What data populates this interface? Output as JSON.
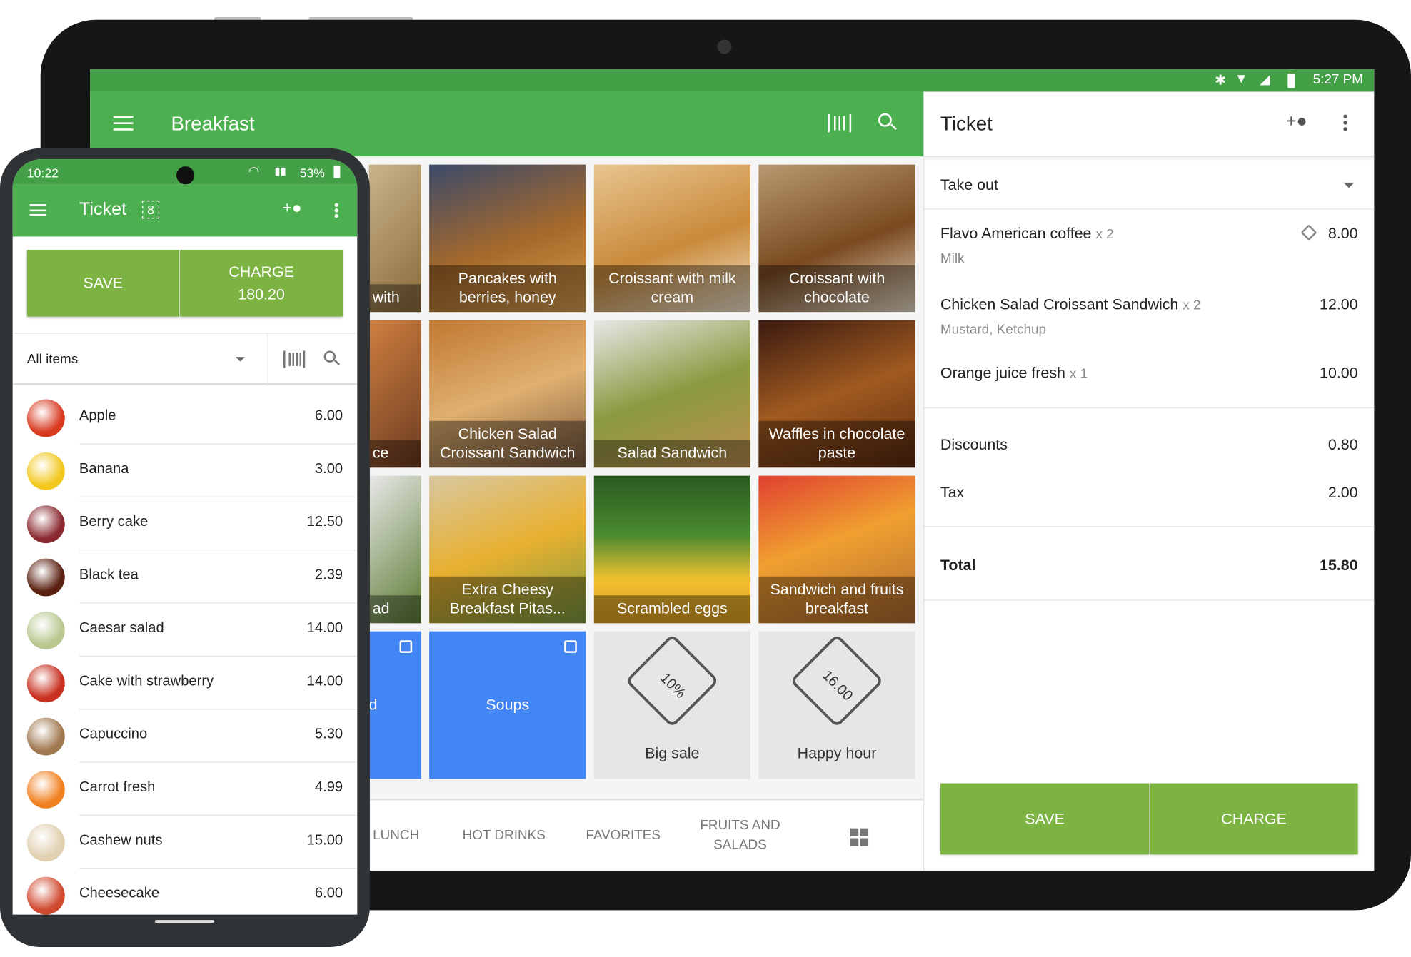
{
  "tablet": {
    "status": {
      "time": "5:27 PM"
    },
    "appbar": {
      "title": "Breakfast"
    },
    "tiles": [
      {
        "label": "with",
        "bg": "linear-gradient(135deg,#c9b48a,#8a6a3a)"
      },
      {
        "label": "Pancakes with berries, honey",
        "bg": "linear-gradient(160deg,#3b4a6a,#a86a2a 55%,#d9a050)"
      },
      {
        "label": "Croissant with milk cream",
        "bg": "linear-gradient(160deg,#e8c590,#c98a3a 55%,#f2e6d0)"
      },
      {
        "label": "Croissant with chocolate",
        "bg": "linear-gradient(160deg,#b89a70,#7a4a20 55%,#e8dcc8)"
      },
      {
        "label": "ce",
        "bg": "linear-gradient(135deg,#d08040,#6a3a20)"
      },
      {
        "label": "Chicken Salad Croissant Sandwich",
        "bg": "linear-gradient(160deg,#c07830,#e0b070 50%,#7a5a40)"
      },
      {
        "label": "Salad Sandwich",
        "bg": "linear-gradient(160deg,#e8e8e8,#8a9a40 50%,#c09050)"
      },
      {
        "label": "Waffles in chocolate paste",
        "bg": "linear-gradient(160deg,#3a1a10,#a05a20 50%,#5a2a10)"
      },
      {
        "label": "ad",
        "bg": "linear-gradient(135deg,#e8e8e8,#5a7a30)"
      },
      {
        "label": "Extra Cheesy Breakfast Pitas...",
        "bg": "linear-gradient(160deg,#d8c8a0,#e8b030 50%,#7a9a40)"
      },
      {
        "label": "Scrambled eggs",
        "bg": "linear-gradient(180deg,#2a5a20,#4a8a30 40%,#f0c030 70%,#e0a020)"
      },
      {
        "label": "Sandwich and fruits breakfast",
        "bg": "linear-gradient(160deg,#e04030,#f0a030 45%,#b06a30)"
      }
    ],
    "category_tiles": [
      {
        "label": "d"
      },
      {
        "label": "Soups"
      }
    ],
    "discount_tiles": [
      {
        "label": "Big sale",
        "tag": "10%"
      },
      {
        "label": "Happy hour",
        "tag": "16.00"
      }
    ],
    "tabs": [
      "LUNCH",
      "HOT DRINKS",
      "FAVORITES",
      "FRUITS AND SALADS"
    ],
    "ticket": {
      "title": "Ticket",
      "dining_option": "Take out",
      "items": [
        {
          "name": "Flavo American coffee",
          "qty": "x 2",
          "modifiers": "Milk",
          "price": "8.00"
        },
        {
          "name": "Chicken Salad Croissant Sandwich",
          "qty": "x 2",
          "modifiers": "Mustard, Ketchup",
          "price": "12.00"
        },
        {
          "name": "Orange juice fresh",
          "qty": "x 1",
          "modifiers": "",
          "price": "10.00"
        }
      ],
      "discounts_label": "Discounts",
      "discounts": "0.80",
      "tax_label": "Tax",
      "tax": "2.00",
      "total_label": "Total",
      "total": "15.80",
      "save": "SAVE",
      "charge": "CHARGE"
    }
  },
  "phone": {
    "status": {
      "time": "10:22",
      "battery": "53%"
    },
    "appbar": {
      "title": "Ticket",
      "ticket_count": "8"
    },
    "save": "SAVE",
    "charge": "CHARGE",
    "charge_amount": "180.20",
    "filter": "All items",
    "items": [
      {
        "name": "Apple",
        "price": "6.00",
        "color": "#d83a20"
      },
      {
        "name": "Banana",
        "price": "3.00",
        "color": "#f2c820"
      },
      {
        "name": "Berry cake",
        "price": "12.50",
        "color": "#8a2a30"
      },
      {
        "name": "Black tea",
        "price": "2.39",
        "color": "#5a2010"
      },
      {
        "name": "Caesar salad",
        "price": "14.00",
        "color": "#b8c890"
      },
      {
        "name": "Cake with strawberry",
        "price": "14.00",
        "color": "#c83020"
      },
      {
        "name": "Capuccino",
        "price": "5.30",
        "color": "#a07850"
      },
      {
        "name": "Carrot fresh",
        "price": "4.99",
        "color": "#f08020"
      },
      {
        "name": "Cashew nuts",
        "price": "15.00",
        "color": "#e0d0b0"
      },
      {
        "name": "Cheesecake",
        "price": "6.00",
        "color": "#d04a30"
      }
    ]
  },
  "colors": {
    "primary": "#4caf50",
    "status": "#43a047",
    "button": "#7cb342",
    "category": "#4285f4"
  }
}
